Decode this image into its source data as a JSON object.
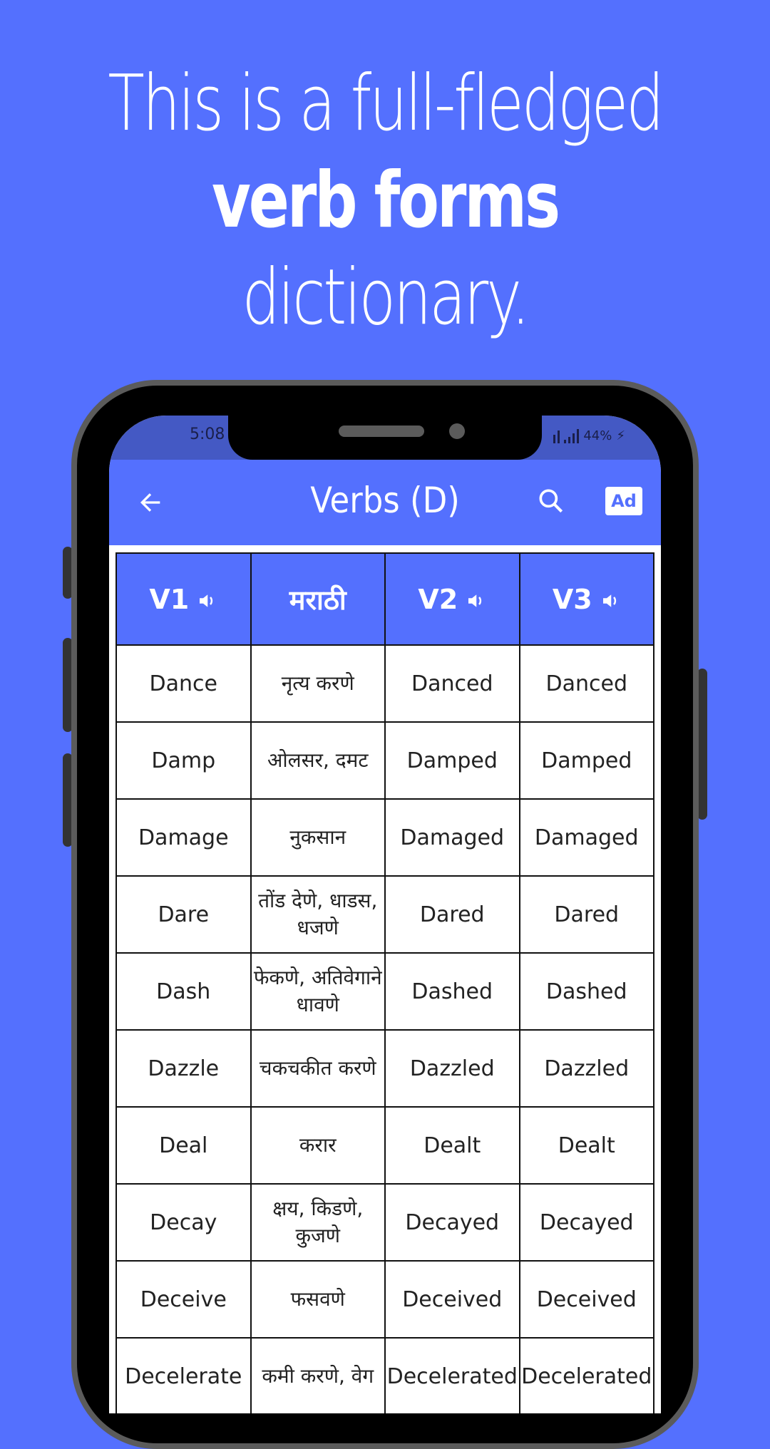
{
  "headline": {
    "line1": "This is a full-fledged",
    "line2": "verb forms",
    "line3": "dictionary."
  },
  "status_bar": {
    "time": "5:08",
    "battery": "44%",
    "icons": [
      "wifi-signal-icon",
      "cell-signal-icon",
      "charging-bolt-icon"
    ]
  },
  "app_bar": {
    "title": "Verbs (D)",
    "back_icon": "arrow-left-icon",
    "search_icon": "search-icon",
    "ad_label": "Ad"
  },
  "table": {
    "headers": [
      {
        "label": "V1",
        "icon": "speaker-icon"
      },
      {
        "label": "मराठी"
      },
      {
        "label": "V2",
        "icon": "speaker-icon"
      },
      {
        "label": "V3",
        "icon": "speaker-icon"
      }
    ],
    "rows": [
      {
        "v1": "Dance",
        "mr": "नृत्य करणे",
        "v2": "Danced",
        "v3": "Danced"
      },
      {
        "v1": "Damp",
        "mr": "ओलसर, दमट",
        "v2": "Damped",
        "v3": "Damped"
      },
      {
        "v1": "Damage",
        "mr": "नुकसान",
        "v2": "Damaged",
        "v3": "Damaged"
      },
      {
        "v1": "Dare",
        "mr": "तोंड देणे, धाडस, धजणे",
        "v2": "Dared",
        "v3": "Dared"
      },
      {
        "v1": "Dash",
        "mr": "फेकणे, अतिवेगाने धावणे",
        "v2": "Dashed",
        "v3": "Dashed"
      },
      {
        "v1": "Dazzle",
        "mr": "चकचकीत करणे",
        "v2": "Dazzled",
        "v3": "Dazzled"
      },
      {
        "v1": "Deal",
        "mr": "करार",
        "v2": "Dealt",
        "v3": "Dealt"
      },
      {
        "v1": "Decay",
        "mr": "क्षय, किडणे, कुजणे",
        "v2": "Decayed",
        "v3": "Decayed"
      },
      {
        "v1": "Deceive",
        "mr": "फसवणे",
        "v2": "Deceived",
        "v3": "Deceived"
      },
      {
        "v1": "Decelerate",
        "mr": "कमी करणे, वेग",
        "v2": "Decelerated",
        "v3": "Decelerated"
      }
    ]
  },
  "colors": {
    "background": "#5470fe",
    "status_bar": "#4459c4",
    "header": "#5470fe"
  }
}
